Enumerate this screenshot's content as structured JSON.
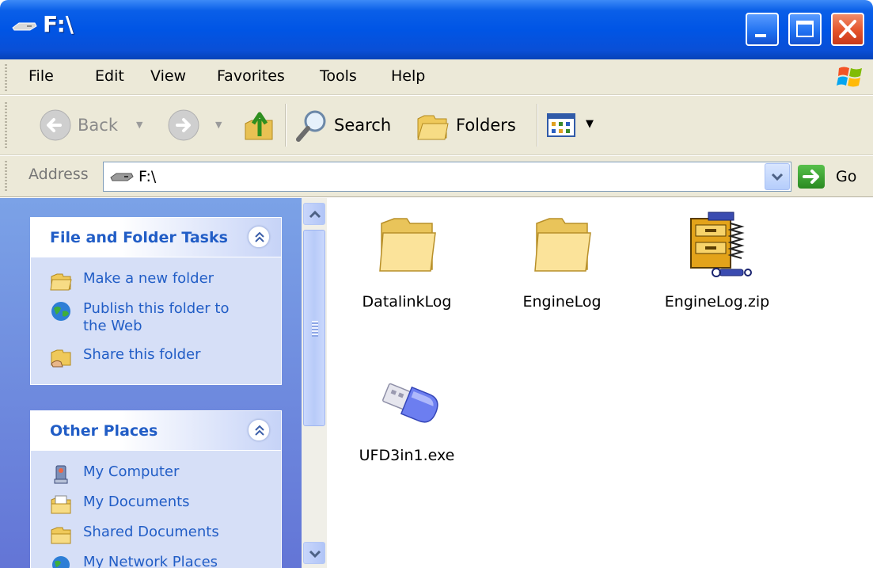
{
  "window": {
    "title": "F:\\"
  },
  "menu": [
    "File",
    "Edit",
    "View",
    "Favorites",
    "Tools",
    "Help"
  ],
  "toolbar": {
    "back": "Back",
    "search": "Search",
    "folders": "Folders"
  },
  "address": {
    "label": "Address",
    "value": "F:\\",
    "go": "Go"
  },
  "tasks_panel": {
    "title": "File and Folder Tasks",
    "items": [
      "Make a new folder",
      "Publish this folder to the Web",
      "Share this folder"
    ]
  },
  "places_panel": {
    "title": "Other Places",
    "items": [
      "My Computer",
      "My Documents",
      "Shared Documents",
      "My Network Places"
    ]
  },
  "files": [
    {
      "name": "DatalinkLog",
      "icon": "folder-icon"
    },
    {
      "name": "EngineLog",
      "icon": "folder-icon"
    },
    {
      "name": "EngineLog.zip",
      "icon": "zip-archive-icon"
    },
    {
      "name": "UFD3in1.exe",
      "icon": "usb-drive-icon"
    }
  ]
}
